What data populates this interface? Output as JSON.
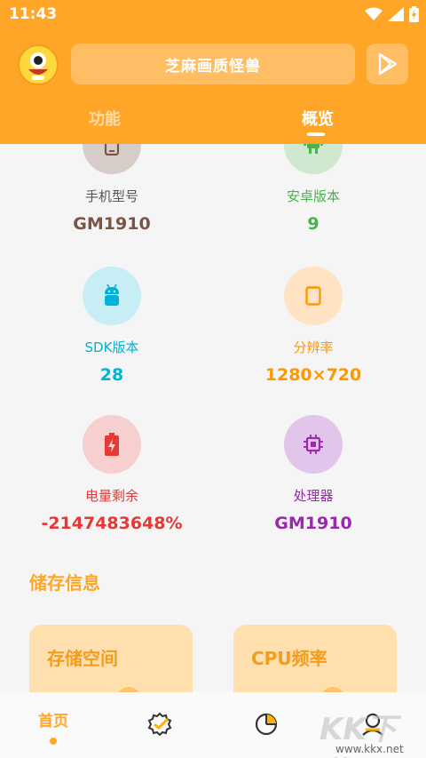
{
  "status": {
    "time": "11:43"
  },
  "header": {
    "app_title": "芝麻画质怪兽",
    "tabs": [
      {
        "label": "功能"
      },
      {
        "label": "概览"
      }
    ],
    "active_tab": "概览"
  },
  "colors": {
    "brand": "#ffa629",
    "phone_model": "#795548",
    "android_version": "#4caf50",
    "sdk_version": "#00b2d6",
    "resolution": "#ff9800",
    "battery": "#e53935",
    "processor": "#9c27b0"
  },
  "overview": {
    "items": [
      {
        "label": "手机型号",
        "value": "GM1910",
        "icon": "phone-icon"
      },
      {
        "label": "安卓版本",
        "value": "9",
        "icon": "android-icon"
      },
      {
        "label": "SDK版本",
        "value": "28",
        "icon": "android-robot-icon"
      },
      {
        "label": "分辨率",
        "value": "1280×720",
        "icon": "screen-icon"
      },
      {
        "label": "电量剩余",
        "value": "-2147483648%",
        "icon": "battery-charging-icon"
      },
      {
        "label": "处理器",
        "value": "GM1910",
        "icon": "cpu-icon"
      }
    ]
  },
  "storage": {
    "section_title": "储存信息",
    "cards": [
      {
        "title": "存储空间"
      },
      {
        "title": "CPU频率"
      }
    ]
  },
  "bottom_nav": {
    "home_label": "首页",
    "items": [
      "home",
      "verified-badge-icon",
      "pie-chart-icon",
      "user-icon"
    ]
  },
  "watermark": {
    "text": "KK下载",
    "url": "www.kkx.net"
  }
}
